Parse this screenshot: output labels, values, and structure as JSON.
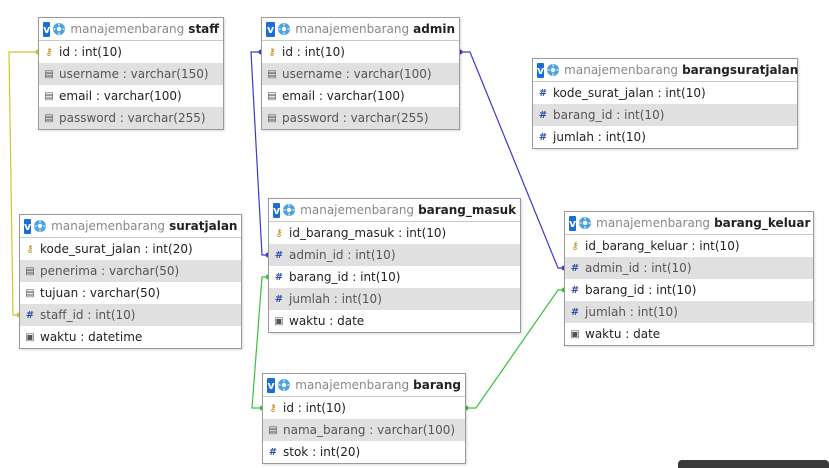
{
  "database": "manajemenbarang",
  "tables": [
    {
      "name": "staff",
      "fields": [
        {
          "text": "id : int(10)",
          "icon": "key-icon"
        },
        {
          "text": "username : varchar(150)",
          "icon": "field-icon"
        },
        {
          "text": "email : varchar(100)",
          "icon": "field-icon"
        },
        {
          "text": "password : varchar(255)",
          "icon": "field-icon"
        }
      ]
    },
    {
      "name": "admin",
      "fields": [
        {
          "text": "id : int(10)",
          "icon": "key-icon"
        },
        {
          "text": "username : varchar(100)",
          "icon": "field-icon"
        },
        {
          "text": "email : varchar(100)",
          "icon": "field-icon"
        },
        {
          "text": "password : varchar(255)",
          "icon": "field-icon"
        }
      ]
    },
    {
      "name": "barangsuratjalan",
      "fields": [
        {
          "text": "kode_surat_jalan : int(10)",
          "icon": "number-icon"
        },
        {
          "text": "barang_id : int(10)",
          "icon": "number-icon"
        },
        {
          "text": "jumlah : int(10)",
          "icon": "number-icon"
        }
      ]
    },
    {
      "name": "suratjalan",
      "fields": [
        {
          "text": "kode_surat_jalan : int(20)",
          "icon": "key-icon"
        },
        {
          "text": "penerima : varchar(50)",
          "icon": "field-icon"
        },
        {
          "text": "tujuan : varchar(50)",
          "icon": "field-icon"
        },
        {
          "text": "staff_id : int(10)",
          "icon": "number-icon"
        },
        {
          "text": "waktu : datetime",
          "icon": "date-icon"
        }
      ]
    },
    {
      "name": "barang_masuk",
      "fields": [
        {
          "text": "id_barang_masuk : int(10)",
          "icon": "key-icon"
        },
        {
          "text": "admin_id : int(10)",
          "icon": "number-icon"
        },
        {
          "text": "barang_id : int(10)",
          "icon": "number-icon"
        },
        {
          "text": "jumlah : int(10)",
          "icon": "number-icon"
        },
        {
          "text": "waktu : date",
          "icon": "date-icon"
        }
      ]
    },
    {
      "name": "barang_keluar",
      "fields": [
        {
          "text": "id_barang_keluar : int(10)",
          "icon": "key-icon"
        },
        {
          "text": "admin_id : int(10)",
          "icon": "number-icon"
        },
        {
          "text": "barang_id : int(10)",
          "icon": "number-icon"
        },
        {
          "text": "jumlah : int(10)",
          "icon": "number-icon"
        },
        {
          "text": "waktu : date",
          "icon": "date-icon"
        }
      ]
    },
    {
      "name": "barang",
      "fields": [
        {
          "text": "id : int(10)",
          "icon": "key-icon"
        },
        {
          "text": "nama_barang : varchar(100)",
          "icon": "field-icon"
        },
        {
          "text": "stok : int(20)",
          "icon": "number-icon"
        }
      ]
    }
  ],
  "relations": [
    {
      "from": "staff.id",
      "to": "suratjalan.staff_id",
      "color": "#c8c832"
    },
    {
      "from": "admin.id",
      "to": "barang_masuk.admin_id",
      "color": "#3a3ad0"
    },
    {
      "from": "admin.id",
      "to": "barang_keluar.admin_id",
      "color": "#3a3ad0"
    },
    {
      "from": "barang.id",
      "to": "barang_masuk.barang_id",
      "color": "#3cc03c"
    },
    {
      "from": "barang.id",
      "to": "barang_keluar.barang_id",
      "color": "#3cc03c"
    }
  ]
}
